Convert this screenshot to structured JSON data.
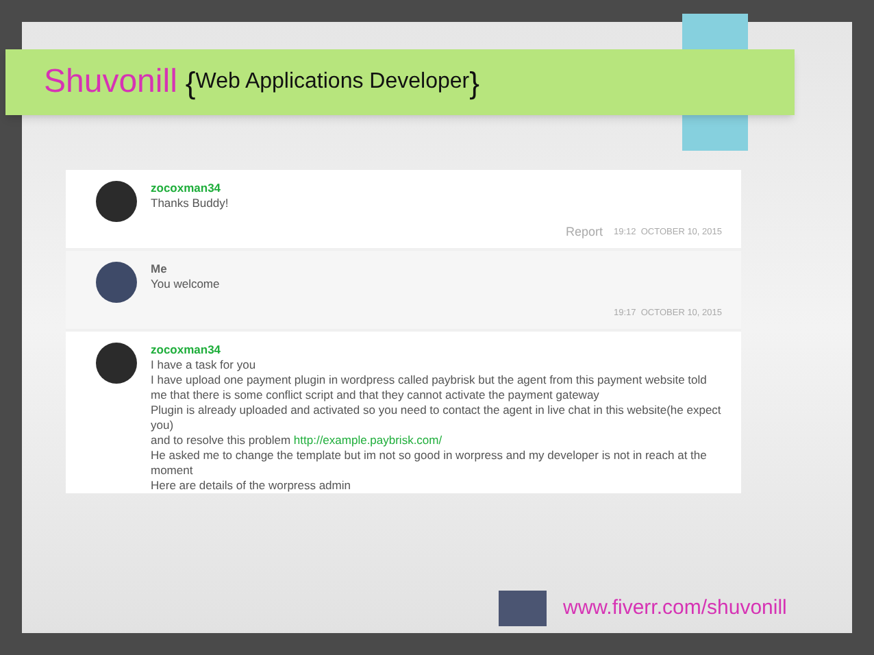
{
  "title": {
    "name": "Shuvonill",
    "brace_open": "{",
    "subtitle": "Web Applications Developer",
    "brace_close": "}"
  },
  "messages": [
    {
      "sender": "zocoxman34",
      "is_me": false,
      "paragraphs": [
        {
          "text": "Thanks Buddy!"
        }
      ],
      "report": "Report",
      "timestamp": "19:12  OCTOBER 10, 2015"
    },
    {
      "sender": "Me",
      "is_me": true,
      "paragraphs": [
        {
          "text": "You welcome"
        }
      ],
      "timestamp": "19:17  OCTOBER 10, 2015"
    },
    {
      "sender": "zocoxman34",
      "is_me": false,
      "paragraphs": [
        {
          "text": "I have a task for you"
        },
        {
          "text": "I have upload one payment plugin in wordpress called paybrisk but the agent from this payment website told me that there is some conflict script and that they cannot activate the payment gateway"
        },
        {
          "text": "Plugin is already uploaded and activated so you need to contact the agent in live chat in this website(he expect you)"
        },
        {
          "text": "and to resolve this problem ",
          "link": "http://example.paybrisk.com/"
        },
        {
          "text": "He asked me to change the template but im not so good in worpress and my developer is not in reach at the moment"
        },
        {
          "text": "Here are details of the worpress admin"
        }
      ]
    }
  ],
  "footer": {
    "link": "www.fiverr.com/shuvonill"
  }
}
